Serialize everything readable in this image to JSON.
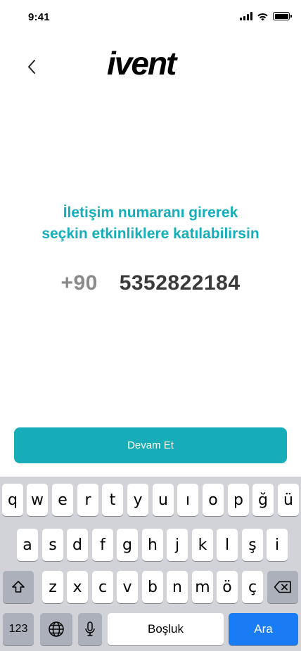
{
  "status_bar": {
    "time": "9:41",
    "icons": [
      "signal-icon",
      "wifi-icon",
      "battery-icon"
    ]
  },
  "header": {
    "back_icon": "chevron-left-icon",
    "logo_text": "ivent"
  },
  "headline": {
    "line1": "İletişim numaranı girerek",
    "line2": "seçkin etkinliklere katılabilirsin"
  },
  "phone": {
    "country_code": "+90",
    "number": "5352822184"
  },
  "continue_button": {
    "label": "Devam Et"
  },
  "keyboard": {
    "row1": [
      "q",
      "w",
      "e",
      "r",
      "t",
      "y",
      "u",
      "ı",
      "o",
      "p",
      "ğ",
      "ü"
    ],
    "row2": [
      "a",
      "s",
      "d",
      "f",
      "g",
      "h",
      "j",
      "k",
      "l",
      "ş",
      "i"
    ],
    "row3": [
      "z",
      "x",
      "c",
      "v",
      "b",
      "n",
      "m",
      "ö",
      "ç"
    ],
    "numbers_label": "123",
    "space_label": "Boşluk",
    "return_label": "Ara",
    "icons": [
      "shift-icon",
      "backspace-icon",
      "globe-icon",
      "microphone-icon"
    ]
  },
  "colors": {
    "accent": "#15aebb",
    "keyboard_bg": "#d1d3d9",
    "return_key": "#1a7cf5"
  }
}
